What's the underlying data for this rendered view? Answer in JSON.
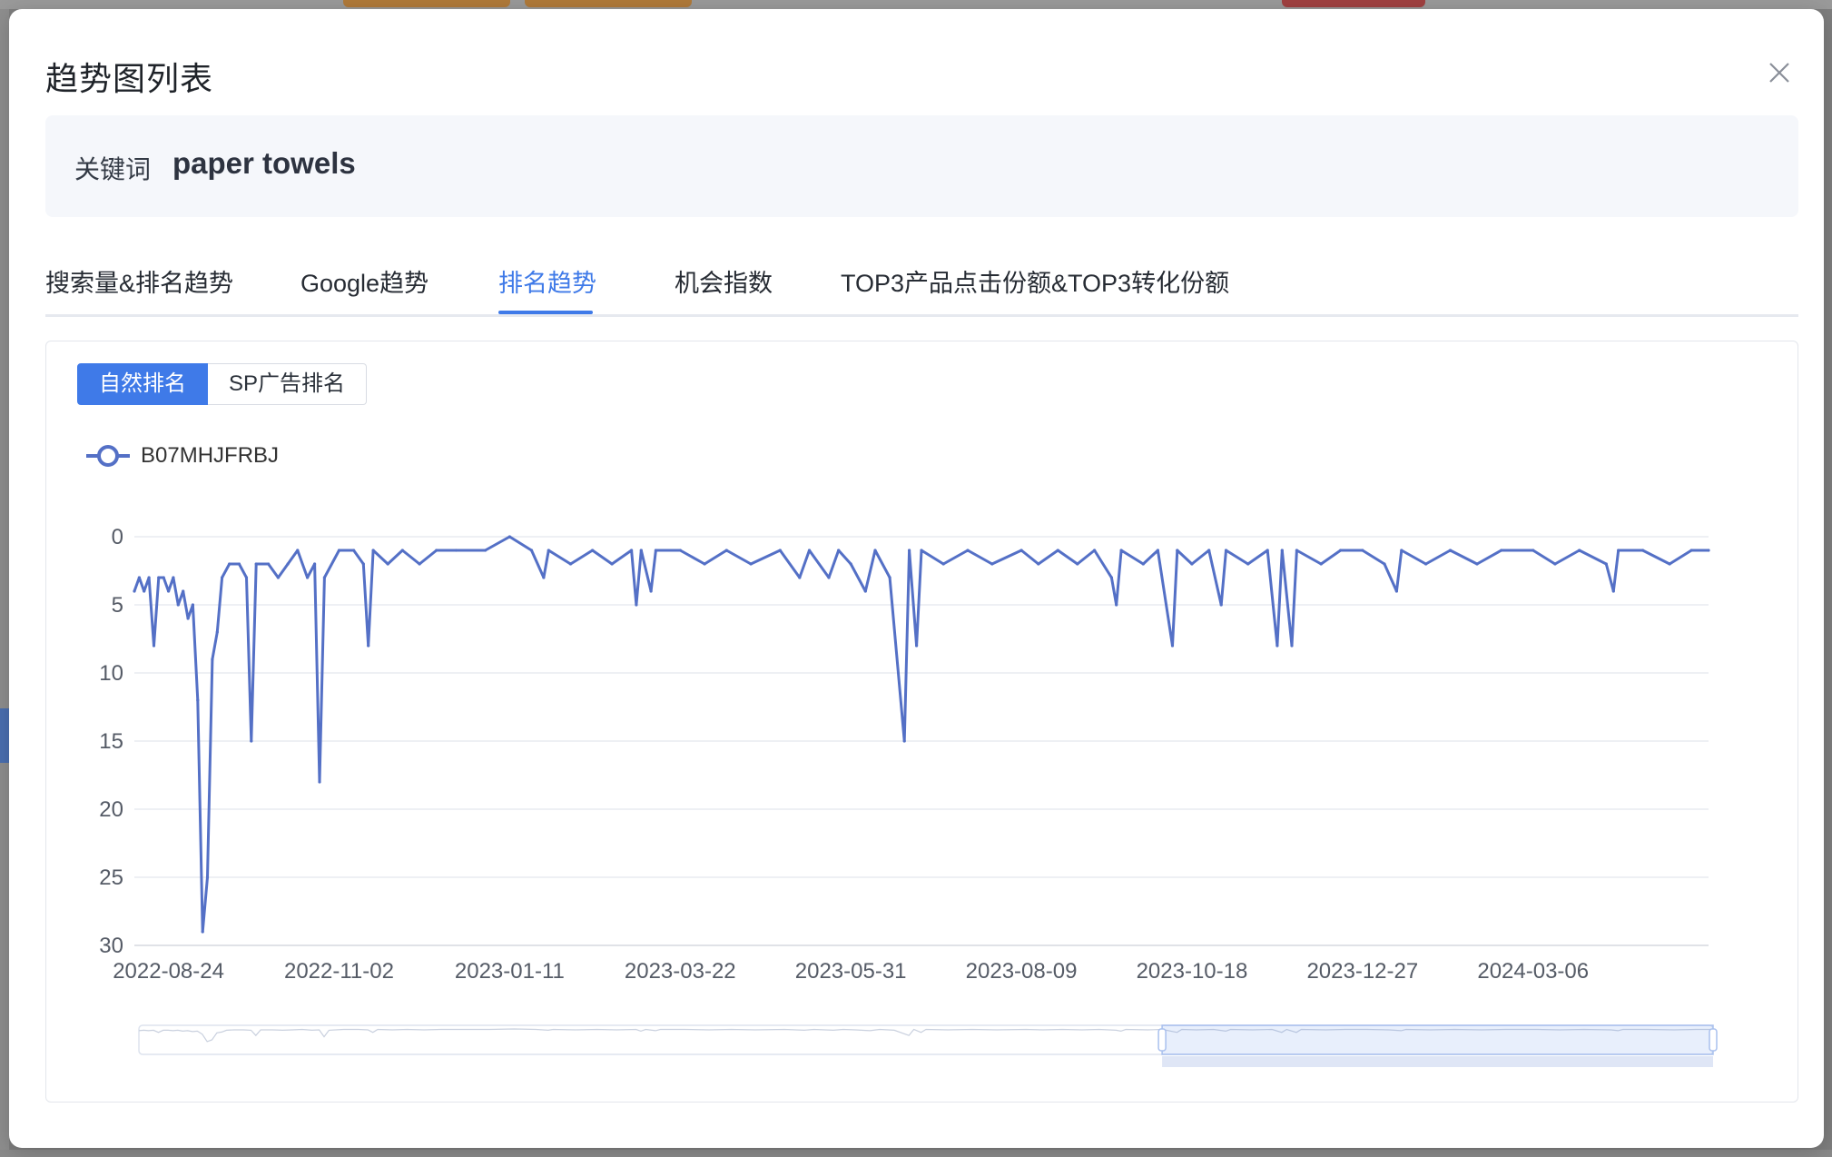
{
  "modal": {
    "title": "趋势图列表",
    "close_icon": "close-icon"
  },
  "keyword": {
    "label": "关键词",
    "value": "paper towels"
  },
  "tabs": [
    {
      "label": "搜索量&排名趋势",
      "active": false
    },
    {
      "label": "Google趋势",
      "active": false
    },
    {
      "label": "排名趋势",
      "active": true
    },
    {
      "label": "机会指数",
      "active": false
    },
    {
      "label": "TOP3产品点击份额&TOP3转化份额",
      "active": false
    }
  ],
  "rank_type": {
    "options": [
      "自然排名",
      "SP广告排名"
    ],
    "selected": "自然排名"
  },
  "colors": {
    "accent": "#3f7ae8",
    "series": "#5470c6"
  },
  "chart_data": {
    "type": "line",
    "title": "",
    "xlabel": "",
    "ylabel": "",
    "y_inverted": true,
    "ylim": [
      0,
      30
    ],
    "yticks": [
      "0",
      "5",
      "10",
      "15",
      "20",
      "25",
      "30"
    ],
    "xticks": [
      "2022-08-24",
      "2022-11-02",
      "2023-01-11",
      "2023-03-22",
      "2023-05-31",
      "2023-08-09",
      "2023-10-18",
      "2023-12-27",
      "2024-03-06"
    ],
    "x_range": [
      "2022-08-10",
      "2024-05-17"
    ],
    "grid": true,
    "legend_position": "top-left",
    "series": [
      {
        "name": "B07MHJFRBJ",
        "points": [
          [
            "2022-08-10",
            4
          ],
          [
            "2022-08-12",
            3
          ],
          [
            "2022-08-14",
            4
          ],
          [
            "2022-08-16",
            3
          ],
          [
            "2022-08-18",
            8
          ],
          [
            "2022-08-20",
            3
          ],
          [
            "2022-08-22",
            3
          ],
          [
            "2022-08-24",
            4
          ],
          [
            "2022-08-26",
            3
          ],
          [
            "2022-08-28",
            5
          ],
          [
            "2022-08-30",
            4
          ],
          [
            "2022-09-01",
            6
          ],
          [
            "2022-09-03",
            5
          ],
          [
            "2022-09-05",
            12
          ],
          [
            "2022-09-07",
            29
          ],
          [
            "2022-09-09",
            25
          ],
          [
            "2022-09-11",
            9
          ],
          [
            "2022-09-13",
            7
          ],
          [
            "2022-09-15",
            3
          ],
          [
            "2022-09-18",
            2
          ],
          [
            "2022-09-22",
            2
          ],
          [
            "2022-09-25",
            3
          ],
          [
            "2022-09-27",
            15
          ],
          [
            "2022-09-29",
            2
          ],
          [
            "2022-10-04",
            2
          ],
          [
            "2022-10-08",
            3
          ],
          [
            "2022-10-12",
            2
          ],
          [
            "2022-10-16",
            1
          ],
          [
            "2022-10-20",
            3
          ],
          [
            "2022-10-23",
            2
          ],
          [
            "2022-10-25",
            18
          ],
          [
            "2022-10-27",
            3
          ],
          [
            "2022-11-02",
            1
          ],
          [
            "2022-11-08",
            1
          ],
          [
            "2022-11-12",
            2
          ],
          [
            "2022-11-14",
            8
          ],
          [
            "2022-11-16",
            1
          ],
          [
            "2022-11-22",
            2
          ],
          [
            "2022-11-28",
            1
          ],
          [
            "2022-12-05",
            2
          ],
          [
            "2022-12-12",
            1
          ],
          [
            "2022-12-20",
            1
          ],
          [
            "2023-01-01",
            1
          ],
          [
            "2023-01-11",
            0
          ],
          [
            "2023-01-20",
            1
          ],
          [
            "2023-01-25",
            3
          ],
          [
            "2023-01-27",
            1
          ],
          [
            "2023-02-05",
            2
          ],
          [
            "2023-02-14",
            1
          ],
          [
            "2023-02-22",
            2
          ],
          [
            "2023-03-02",
            1
          ],
          [
            "2023-03-04",
            5
          ],
          [
            "2023-03-06",
            1
          ],
          [
            "2023-03-10",
            4
          ],
          [
            "2023-03-12",
            1
          ],
          [
            "2023-03-22",
            1
          ],
          [
            "2023-04-01",
            2
          ],
          [
            "2023-04-10",
            1
          ],
          [
            "2023-04-20",
            2
          ],
          [
            "2023-05-02",
            1
          ],
          [
            "2023-05-10",
            3
          ],
          [
            "2023-05-14",
            1
          ],
          [
            "2023-05-22",
            3
          ],
          [
            "2023-05-26",
            1
          ],
          [
            "2023-05-31",
            2
          ],
          [
            "2023-06-06",
            4
          ],
          [
            "2023-06-10",
            1
          ],
          [
            "2023-06-16",
            3
          ],
          [
            "2023-06-22",
            15
          ],
          [
            "2023-06-24",
            1
          ],
          [
            "2023-06-27",
            8
          ],
          [
            "2023-06-29",
            1
          ],
          [
            "2023-07-08",
            2
          ],
          [
            "2023-07-18",
            1
          ],
          [
            "2023-07-28",
            2
          ],
          [
            "2023-08-09",
            1
          ],
          [
            "2023-08-16",
            2
          ],
          [
            "2023-08-24",
            1
          ],
          [
            "2023-09-01",
            2
          ],
          [
            "2023-09-08",
            1
          ],
          [
            "2023-09-15",
            3
          ],
          [
            "2023-09-17",
            5
          ],
          [
            "2023-09-19",
            1
          ],
          [
            "2023-09-28",
            2
          ],
          [
            "2023-10-04",
            1
          ],
          [
            "2023-10-10",
            8
          ],
          [
            "2023-10-12",
            1
          ],
          [
            "2023-10-18",
            2
          ],
          [
            "2023-10-25",
            1
          ],
          [
            "2023-10-30",
            5
          ],
          [
            "2023-11-01",
            1
          ],
          [
            "2023-11-10",
            2
          ],
          [
            "2023-11-18",
            1
          ],
          [
            "2023-11-22",
            8
          ],
          [
            "2023-11-24",
            1
          ],
          [
            "2023-11-28",
            8
          ],
          [
            "2023-11-30",
            1
          ],
          [
            "2023-12-10",
            2
          ],
          [
            "2023-12-18",
            1
          ],
          [
            "2023-12-27",
            1
          ],
          [
            "2024-01-05",
            2
          ],
          [
            "2024-01-10",
            4
          ],
          [
            "2024-01-12",
            1
          ],
          [
            "2024-01-22",
            2
          ],
          [
            "2024-02-01",
            1
          ],
          [
            "2024-02-12",
            2
          ],
          [
            "2024-02-22",
            1
          ],
          [
            "2024-03-06",
            1
          ],
          [
            "2024-03-15",
            2
          ],
          [
            "2024-03-25",
            1
          ],
          [
            "2024-04-05",
            2
          ],
          [
            "2024-04-08",
            4
          ],
          [
            "2024-04-10",
            1
          ],
          [
            "2024-04-20",
            1
          ],
          [
            "2024-05-01",
            2
          ],
          [
            "2024-05-10",
            1
          ],
          [
            "2024-05-17",
            1
          ]
        ]
      }
    ],
    "data_zoom": {
      "start": 0.65,
      "end": 1.0
    }
  }
}
